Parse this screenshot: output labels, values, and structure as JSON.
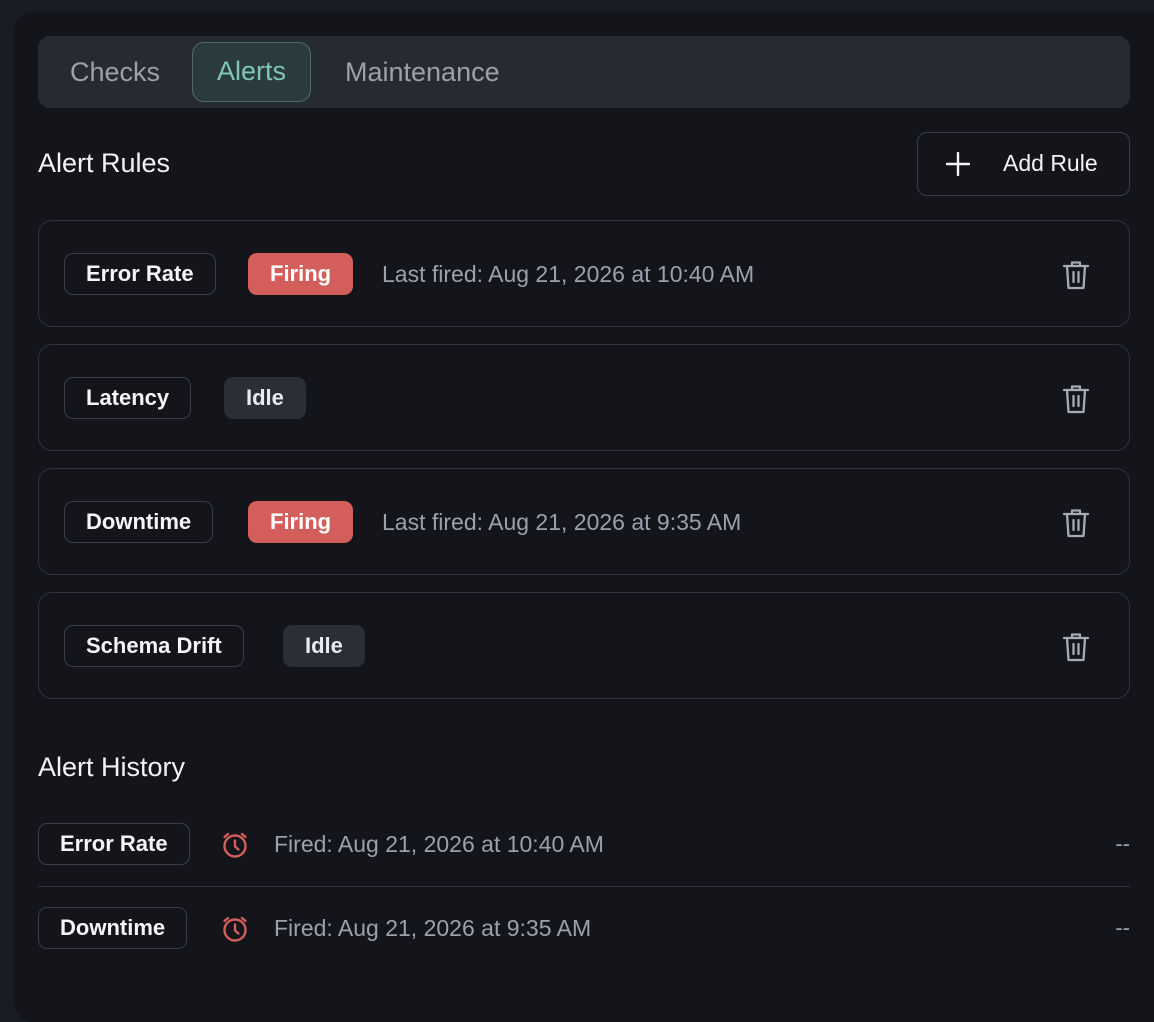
{
  "tabs": [
    {
      "label": "Checks",
      "active": false
    },
    {
      "label": "Alerts",
      "active": true
    },
    {
      "label": "Maintenance",
      "active": false
    }
  ],
  "alert_rules": {
    "title": "Alert Rules",
    "add_label": "Add Rule",
    "items": [
      {
        "name": "Error Rate",
        "status": "Firing",
        "last_fired": "Last fired: Aug 21, 2026 at 10:40 AM"
      },
      {
        "name": "Latency",
        "status": "Idle",
        "last_fired": ""
      },
      {
        "name": "Downtime",
        "status": "Firing",
        "last_fired": "Last fired: Aug 21, 2026 at 9:35 AM"
      },
      {
        "name": "Schema Drift",
        "status": "Idle",
        "last_fired": ""
      }
    ]
  },
  "alert_history": {
    "title": "Alert History",
    "items": [
      {
        "name": "Error Rate",
        "fired": "Fired: Aug 21, 2026 at 10:40 AM",
        "value": "--"
      },
      {
        "name": "Downtime",
        "fired": "Fired: Aug 21, 2026 at 9:35 AM",
        "value": "--"
      }
    ]
  },
  "colors": {
    "accent": "#7fc6b8",
    "firing": "#d45e5b",
    "idle": "#2a2e37",
    "background": "#13151b"
  }
}
